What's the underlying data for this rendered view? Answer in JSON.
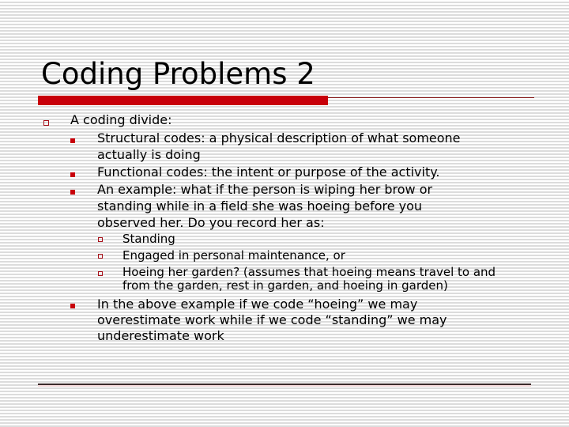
{
  "slide": {
    "title": "Coding Problems 2",
    "colors": {
      "accent": "#c8000a",
      "stripe": "#dcdcdc"
    },
    "bullets": [
      {
        "level": 1,
        "icon": "hollow-square-bullet-icon",
        "lines": [
          "A coding divide:"
        ]
      },
      {
        "level": 2,
        "icon": "filled-square-bullet-icon",
        "lines": [
          "Structural codes: a physical description of what someone",
          "actually is doing"
        ]
      },
      {
        "level": 2,
        "icon": "filled-square-bullet-icon",
        "lines": [
          "Functional codes: the intent or purpose of the activity."
        ]
      },
      {
        "level": 2,
        "icon": "filled-square-bullet-icon",
        "lines": [
          "An example: what if the person is wiping her brow or",
          "standing while in a field she was hoeing before you",
          "observed her.  Do you record her as:"
        ]
      },
      {
        "level": 3,
        "icon": "hollow-square-bullet-icon",
        "lines": [
          "Standing"
        ]
      },
      {
        "level": 3,
        "icon": "hollow-square-bullet-icon",
        "lines": [
          "Engaged in personal maintenance, or"
        ]
      },
      {
        "level": 3,
        "icon": "hollow-square-bullet-icon",
        "lines": [
          "Hoeing her garden? (assumes that hoeing means travel to and",
          "from the garden, rest in garden, and hoeing in garden)"
        ]
      },
      {
        "level": 2,
        "icon": "filled-square-bullet-icon",
        "lines": [
          "In the above example if we code “hoeing” we may",
          "overestimate work while if we code “standing” we may",
          "underestimate work"
        ]
      }
    ]
  }
}
